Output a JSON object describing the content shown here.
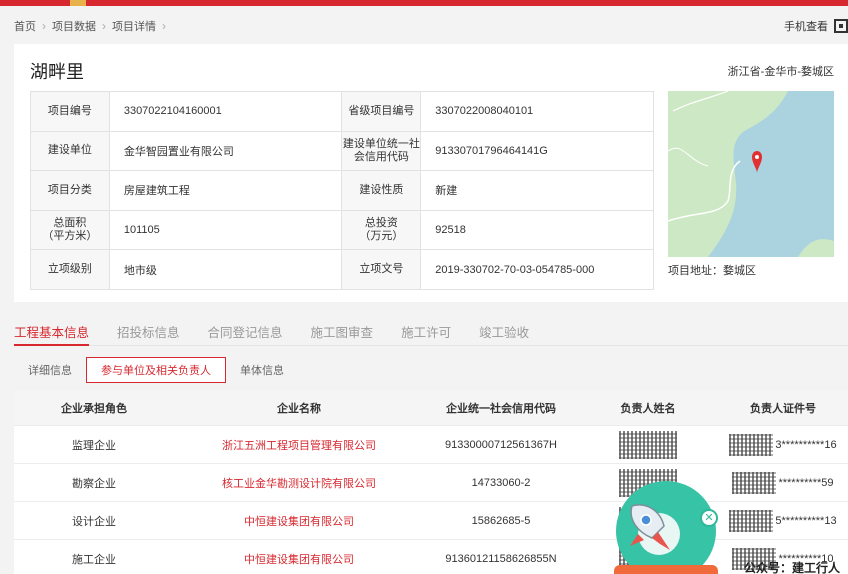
{
  "breadcrumb": [
    "首页",
    "项目数据",
    "项目详情"
  ],
  "mobile_view": "手机查看",
  "project": {
    "name": "湖畔里",
    "location": "浙江省-金华市-婺城区",
    "map_address": "项目地址：婺城区"
  },
  "info": [
    {
      "k1": "项目编号",
      "v1": "3307022104160001",
      "k2": "省级项目编号",
      "v2": "3307022008040101"
    },
    {
      "k1": "建设单位",
      "v1": "金华智园置业有限公司",
      "k2": "建设单位统一社会信用代码",
      "v2": "91330701796464141G"
    },
    {
      "k1": "项目分类",
      "v1": "房屋建筑工程",
      "k2": "建设性质",
      "v2": "新建"
    },
    {
      "k1": "总面积\n（平方米）",
      "v1": "101105",
      "k2": "总投资\n（万元）",
      "v2": "92518"
    },
    {
      "k1": "立项级别",
      "v1": "地市级",
      "k2": "立项文号",
      "v2": "2019-330702-70-03-054785-000"
    }
  ],
  "tabs": [
    "工程基本信息",
    "招投标信息",
    "合同登记信息",
    "施工图审查",
    "施工许可",
    "竣工验收"
  ],
  "subtabs": [
    "详细信息",
    "参与单位及相关负责人",
    "单体信息"
  ],
  "grid": {
    "headers": [
      "企业承担角色",
      "企业名称",
      "企业统一社会信用代码",
      "负责人姓名",
      "负责人证件号"
    ],
    "rows": [
      {
        "role": "监理企业",
        "name": "浙江五洲工程项目管理有限公司",
        "code": "91330000712561367H",
        "id_suffix": "3**********16"
      },
      {
        "role": "勘察企业",
        "name": "核工业金华勘测设计院有限公司",
        "code": "14733060-2",
        "id_suffix": "**********59"
      },
      {
        "role": "设计企业",
        "name": "中恒建设集团有限公司",
        "code": "15862685-5",
        "id_suffix": "5**********13"
      },
      {
        "role": "施工企业",
        "name": "中恒建设集团有限公司",
        "code": "91360121158626855N",
        "id_suffix": "**********10"
      }
    ]
  },
  "watermark": "公众号：建工行人",
  "colors": {
    "accent": "#d7282f",
    "map_water": "#aad3df",
    "map_land": "#cde8c4"
  }
}
